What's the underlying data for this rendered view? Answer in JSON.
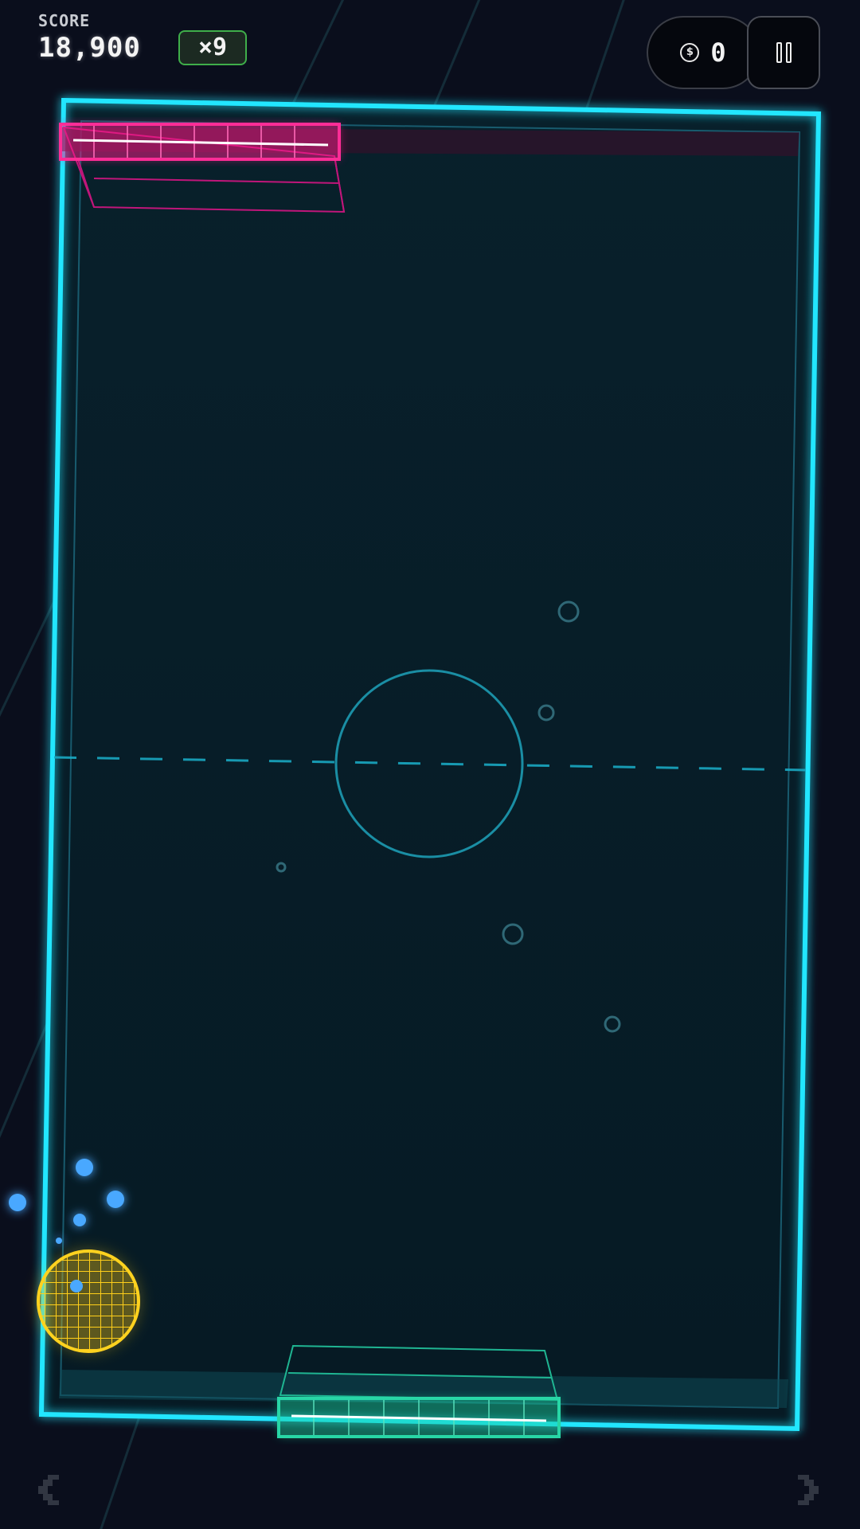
{
  "hud": {
    "score_label": "SCORE",
    "score_value": "18,900",
    "multiplier": "×9",
    "coins": "0"
  },
  "colors": {
    "background": "#0a0e1c",
    "field": "#06222e",
    "border_cyan": "#22e6ff",
    "paddle_top": "#ff1a8c",
    "paddle_bottom": "#28d6a6",
    "ball": "#ffcc14",
    "particles": "#4aa8ff",
    "multiplier_border": "#3fae4a"
  },
  "icons": {
    "coin": "dollar-coin-icon",
    "pause": "pause-icon",
    "nav_left": "chevron-left-icon",
    "nav_right": "chevron-right-icon"
  }
}
